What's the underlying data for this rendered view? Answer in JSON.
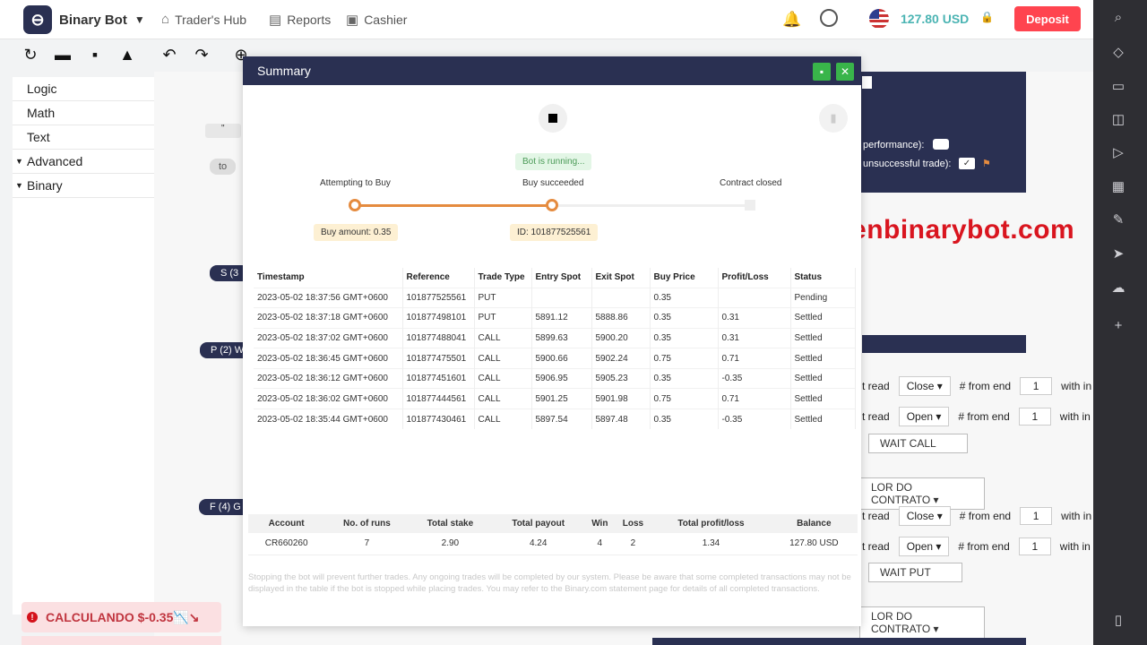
{
  "nav": {
    "app_name": "Binary Bot",
    "links": [
      "Trader's Hub",
      "Reports",
      "Cashier"
    ],
    "balance": "127.80 USD",
    "deposit": "Deposit"
  },
  "categories": [
    "Logic",
    "Math",
    "Text",
    "Advanced",
    "Binary"
  ],
  "workspace": {
    "watermark": "provenbinarybot.com",
    "perf_label": "performance):",
    "unsucc_label": "unsuccessful trade):",
    "pill_s": "S (3",
    "pill_p": "P (2) W",
    "pill_f": "F (4) G",
    "to_label": "to",
    "quote_label": "\"",
    "rows": [
      {
        "lead": "t read",
        "candle": "Close ▾",
        "from": "# from end",
        "num": "1",
        "tail": "with in"
      },
      {
        "lead": "t read",
        "candle": "Open ▾",
        "from": "# from end",
        "num": "1",
        "tail": "with in"
      },
      {
        "lead": "t read",
        "candle": "Close ▾",
        "from": "# from end",
        "num": "1",
        "tail": "with in"
      },
      {
        "lead": "t read",
        "candle": "Open ▾",
        "from": "# from end",
        "num": "1",
        "tail": "with in"
      }
    ],
    "wait_call": "WAIT CALL",
    "wait_put": "WAIT PUT",
    "contrato_1": "LOR DO CONTRATO ▾",
    "contrato_2": "LOR DO CONTRATO ▾"
  },
  "toast": "CALCULANDO $-0.35📉↘",
  "modal": {
    "title": "Summary",
    "status": "Bot is running...",
    "steps": [
      "Attempting to Buy",
      "Buy succeeded",
      "Contract closed"
    ],
    "buy_amount": "Buy amount: 0.35",
    "contract_id": "ID: 101877525561",
    "columns": [
      "Timestamp",
      "Reference",
      "Trade Type",
      "Entry Spot",
      "Exit Spot",
      "Buy Price",
      "Profit/Loss",
      "Status"
    ],
    "rows": [
      [
        "2023-05-02 18:37:56 GMT+0600",
        "101877525561",
        "PUT",
        "",
        "",
        "0.35",
        "",
        "Pending"
      ],
      [
        "2023-05-02 18:37:18 GMT+0600",
        "101877498101",
        "PUT",
        "5891.12",
        "5888.86",
        "0.35",
        "0.31",
        "Settled"
      ],
      [
        "2023-05-02 18:37:02 GMT+0600",
        "101877488041",
        "CALL",
        "5899.63",
        "5900.20",
        "0.35",
        "0.31",
        "Settled"
      ],
      [
        "2023-05-02 18:36:45 GMT+0600",
        "101877475501",
        "CALL",
        "5900.66",
        "5902.24",
        "0.75",
        "0.71",
        "Settled"
      ],
      [
        "2023-05-02 18:36:12 GMT+0600",
        "101877451601",
        "CALL",
        "5906.95",
        "5905.23",
        "0.35",
        "-0.35",
        "Settled"
      ],
      [
        "2023-05-02 18:36:02 GMT+0600",
        "101877444561",
        "CALL",
        "5901.25",
        "5901.98",
        "0.75",
        "0.71",
        "Settled"
      ],
      [
        "2023-05-02 18:35:44 GMT+0600",
        "101877430461",
        "CALL",
        "5897.54",
        "5897.48",
        "0.35",
        "-0.35",
        "Settled"
      ]
    ],
    "summary_columns": [
      "Account",
      "No. of runs",
      "Total stake",
      "Total payout",
      "Win",
      "Loss",
      "Total profit/loss",
      "Balance"
    ],
    "summary_values": [
      "CR660260",
      "7",
      "2.90",
      "4.24",
      "4",
      "2",
      "1.34",
      "127.80 USD"
    ],
    "disclaimer": "Stopping the bot will prevent further trades. Any ongoing trades will be completed by our system. Please be aware that some completed transactions may not be displayed in the table if the bot is stopped while placing trades. You may refer to the Binary.com statement page for details of all completed transactions."
  },
  "colors": {
    "navy": "#2a3052",
    "deposit": "#ff444f",
    "profit": "#3d9b3d",
    "loss": "#d4121b",
    "progress": "#e58b3f"
  }
}
